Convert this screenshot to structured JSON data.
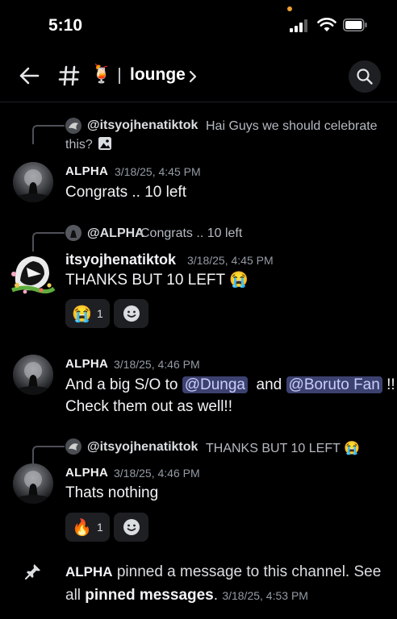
{
  "status_bar": {
    "time": "5:10"
  },
  "header": {
    "channel_emoji": "🍹",
    "channel_name": "lounge",
    "icons": [
      "back-arrow-icon",
      "hash-icon",
      "chevron-right-icon",
      "search-icon"
    ]
  },
  "messages": [
    {
      "reply": {
        "author": "@itsyojhenatiktok",
        "text": "Hai Guys we should celebrate",
        "text2": "this?",
        "attachment_icon": "image-icon"
      },
      "author": "ALPHA",
      "timestamp": "3/18/25, 4:45 PM",
      "text": "Congrats .. 10 left"
    },
    {
      "reply": {
        "author_prefix": "@",
        "author": "ALPHA",
        "text": "Congrats .. 10 left"
      },
      "author": "itsyojhenatiktok",
      "timestamp": "3/18/25, 4:45 PM",
      "text": "THANKS BUT 10 LEFT 😭",
      "reactions": [
        {
          "emoji": "😭",
          "count": "1"
        }
      ]
    },
    {
      "author": "ALPHA",
      "timestamp": "3/18/25, 4:46 PM",
      "text_before": "And a big S/O to ",
      "mention1": "@Dunga",
      "text_mid": "and",
      "mention2": "@Boruto Fan",
      "text_after": " !!",
      "line2": "Check them out as well!!"
    },
    {
      "reply": {
        "author": "@itsyojhenatiktok",
        "text": "THANKS BUT 10 LEFT 😭"
      },
      "author": "ALPHA",
      "timestamp": "3/18/25, 4:46 PM",
      "text": "Thats nothing",
      "reactions": [
        {
          "emoji": "🔥",
          "count": "1"
        }
      ]
    }
  ],
  "system": {
    "author": "ALPHA",
    "text1": " pinned a message to this channel. See",
    "text2_pre": "all ",
    "link": "pinned messages",
    "text2_post": ".",
    "timestamp": "3/18/25, 4:53 PM"
  },
  "colors": {
    "background": "#000000",
    "mention_bg": "#3c4270",
    "mention_text": "#c9cdfb",
    "muted": "#949ba4"
  }
}
